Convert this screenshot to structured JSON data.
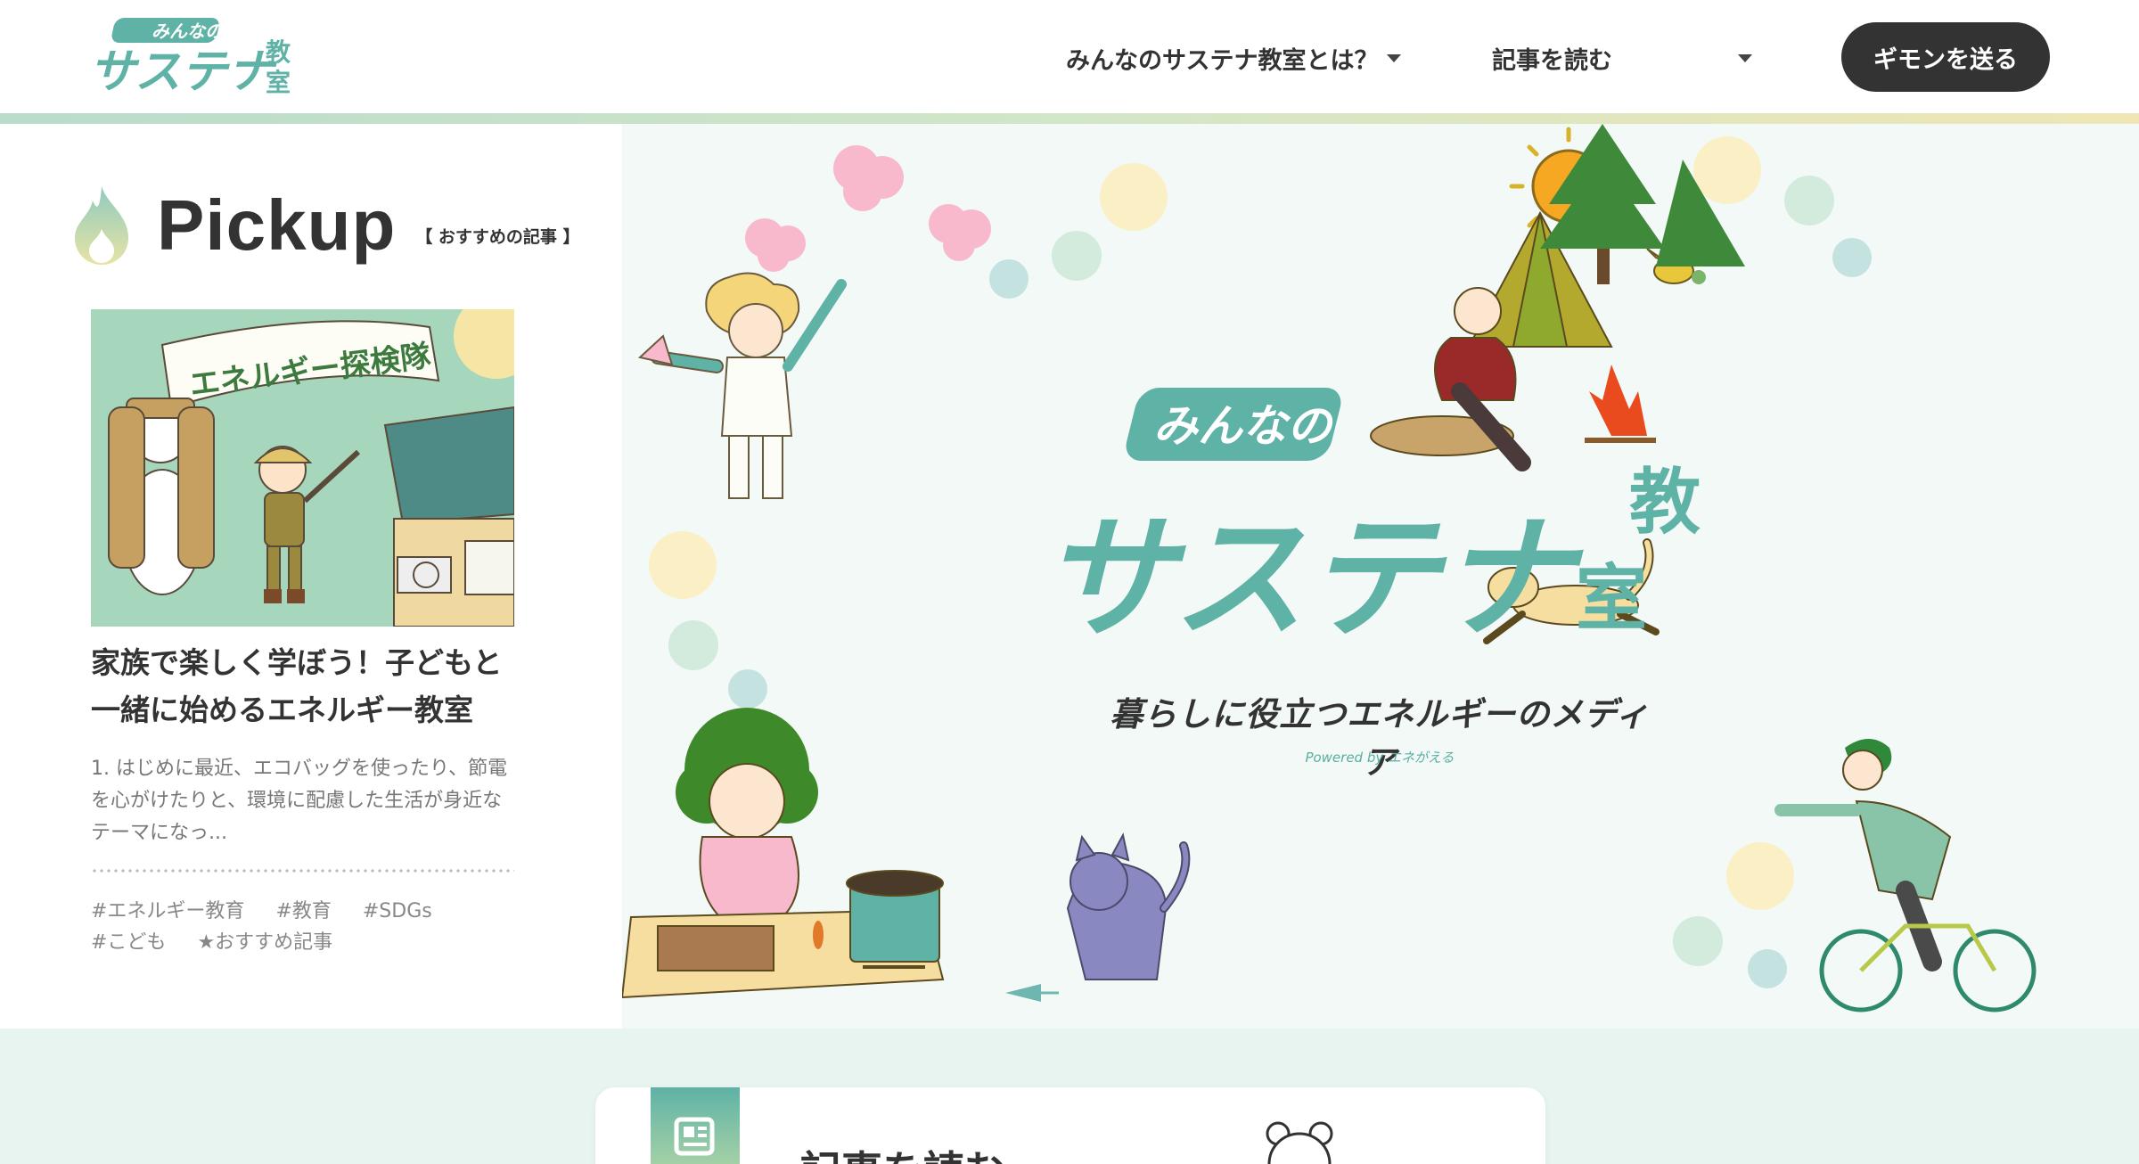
{
  "header": {
    "logo_line1": "みんなの",
    "logo_line2": "サステナ",
    "logo_kanji1": "教",
    "logo_kanji2": "室",
    "nav": [
      {
        "label": "みんなのサステナ教室とは？",
        "has_dropdown": true
      },
      {
        "label": "記事を読む",
        "has_dropdown": false
      },
      {
        "label": "",
        "has_dropdown": true
      }
    ],
    "cta_label": "ギモンを送る"
  },
  "pickup": {
    "title": "Pickup",
    "subtitle": "【 おすすめの記事 】",
    "card": {
      "image_banner_text": "エネルギー探検隊",
      "title": "家族で楽しく学ぼう！子どもと一緒に始めるエネルギー教室",
      "excerpt": "1. はじめに最近、エコバッグを使ったり、節電を心がけたりと、環境に配慮した生活が身近なテーマになっ...",
      "tags": [
        "#エネルギー教育",
        "#教育",
        "#SDGs",
        "#こども",
        "★おすすめ記事"
      ]
    }
  },
  "hero": {
    "logo_line1": "みんなの",
    "logo_line2": "サステナ",
    "logo_kanji1": "教",
    "logo_kanji2": "室",
    "tagline": "暮らしに役立つエネルギーのメディア",
    "powered_by": "Powered by エネがえる"
  },
  "bottom": {
    "read_label": "記事を読む"
  },
  "colors": {
    "brand_teal": "#5fb2a6",
    "dark": "#333333",
    "hero_bg": "#f3f9f6",
    "bottom_bg": "#e8f4ef"
  }
}
